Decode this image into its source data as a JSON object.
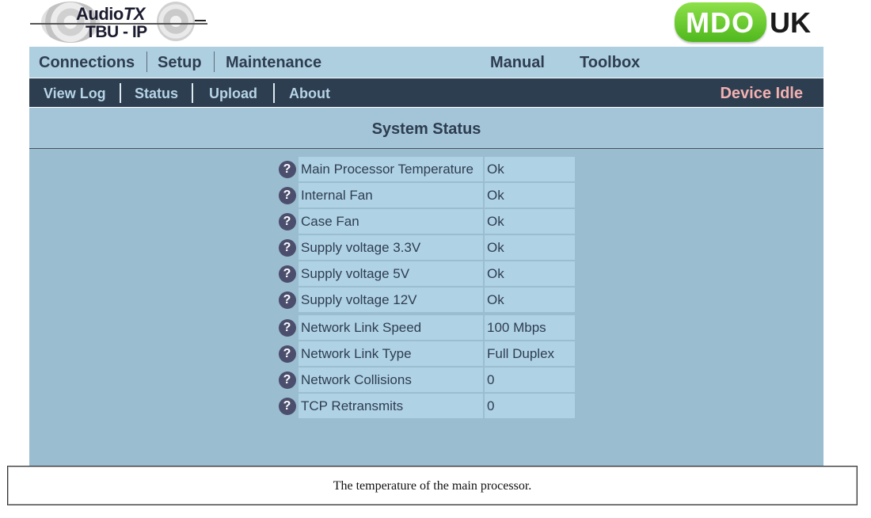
{
  "logo_left": {
    "line1": "Audio",
    "line1_suffix": "TX",
    "line2": "TBU - IP"
  },
  "logo_right": {
    "brand": "MDO",
    "suffix": "UK"
  },
  "main_nav": {
    "connections": "Connections",
    "setup": "Setup",
    "maintenance": "Maintenance",
    "manual": "Manual",
    "toolbox": "Toolbox"
  },
  "sub_nav": {
    "view_log": "View Log",
    "status": "Status",
    "upload": "Upload",
    "about": "About",
    "device_state": "Device Idle"
  },
  "page": {
    "title": "System Status"
  },
  "status_rows": [
    {
      "label": "Main Processor Temperature",
      "value": "Ok"
    },
    {
      "label": "Internal Fan",
      "value": "Ok"
    },
    {
      "label": "Case Fan",
      "value": "Ok"
    },
    {
      "label": "Supply voltage 3.3V",
      "value": "Ok"
    },
    {
      "label": "Supply voltage 5V",
      "value": "Ok"
    },
    {
      "label": "Supply voltage 12V",
      "value": "Ok"
    },
    {
      "label": "Network Link Speed",
      "value": "100 Mbps"
    },
    {
      "label": "Network Link Type",
      "value": "Full Duplex"
    },
    {
      "label": "Network Collisions",
      "value": "0"
    },
    {
      "label": "TCP Retransmits",
      "value": "0"
    }
  ],
  "help_icon_glyph": "?",
  "help_box": {
    "text": "The temperature of the main processor."
  },
  "colors": {
    "main_nav_bg": "#aecfe0",
    "sub_nav_bg": "#2c3e50",
    "content_bg": "#9bbdd0",
    "device_state_color": "#f3b1b1",
    "brand_green": "#5cc424"
  }
}
